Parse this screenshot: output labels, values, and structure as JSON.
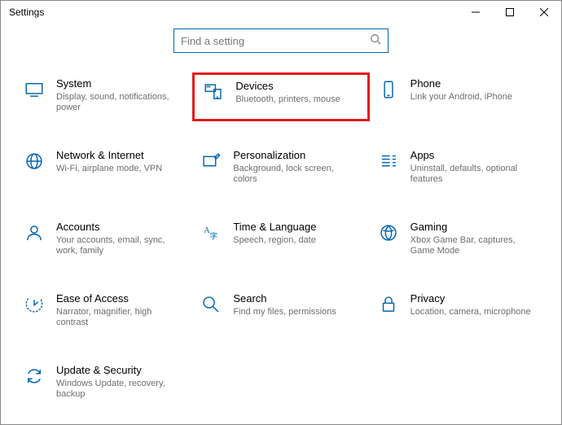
{
  "window_title": "Settings",
  "search": {
    "placeholder": "Find a setting"
  },
  "tiles": [
    {
      "title": "System",
      "sub": "Display, sound, notifications, power"
    },
    {
      "title": "Devices",
      "sub": "Bluetooth, printers, mouse"
    },
    {
      "title": "Phone",
      "sub": "Link your Android, iPhone"
    },
    {
      "title": "Network & Internet",
      "sub": "Wi-Fi, airplane mode, VPN"
    },
    {
      "title": "Personalization",
      "sub": "Background, lock screen, colors"
    },
    {
      "title": "Apps",
      "sub": "Uninstall, defaults, optional features"
    },
    {
      "title": "Accounts",
      "sub": "Your accounts, email, sync, work, family"
    },
    {
      "title": "Time & Language",
      "sub": "Speech, region, date"
    },
    {
      "title": "Gaming",
      "sub": "Xbox Game Bar, captures, Game Mode"
    },
    {
      "title": "Ease of Access",
      "sub": "Narrator, magnifier, high contrast"
    },
    {
      "title": "Search",
      "sub": "Find my files, permissions"
    },
    {
      "title": "Privacy",
      "sub": "Location, camera, microphone"
    },
    {
      "title": "Update & Security",
      "sub": "Windows Update, recovery, backup"
    }
  ]
}
